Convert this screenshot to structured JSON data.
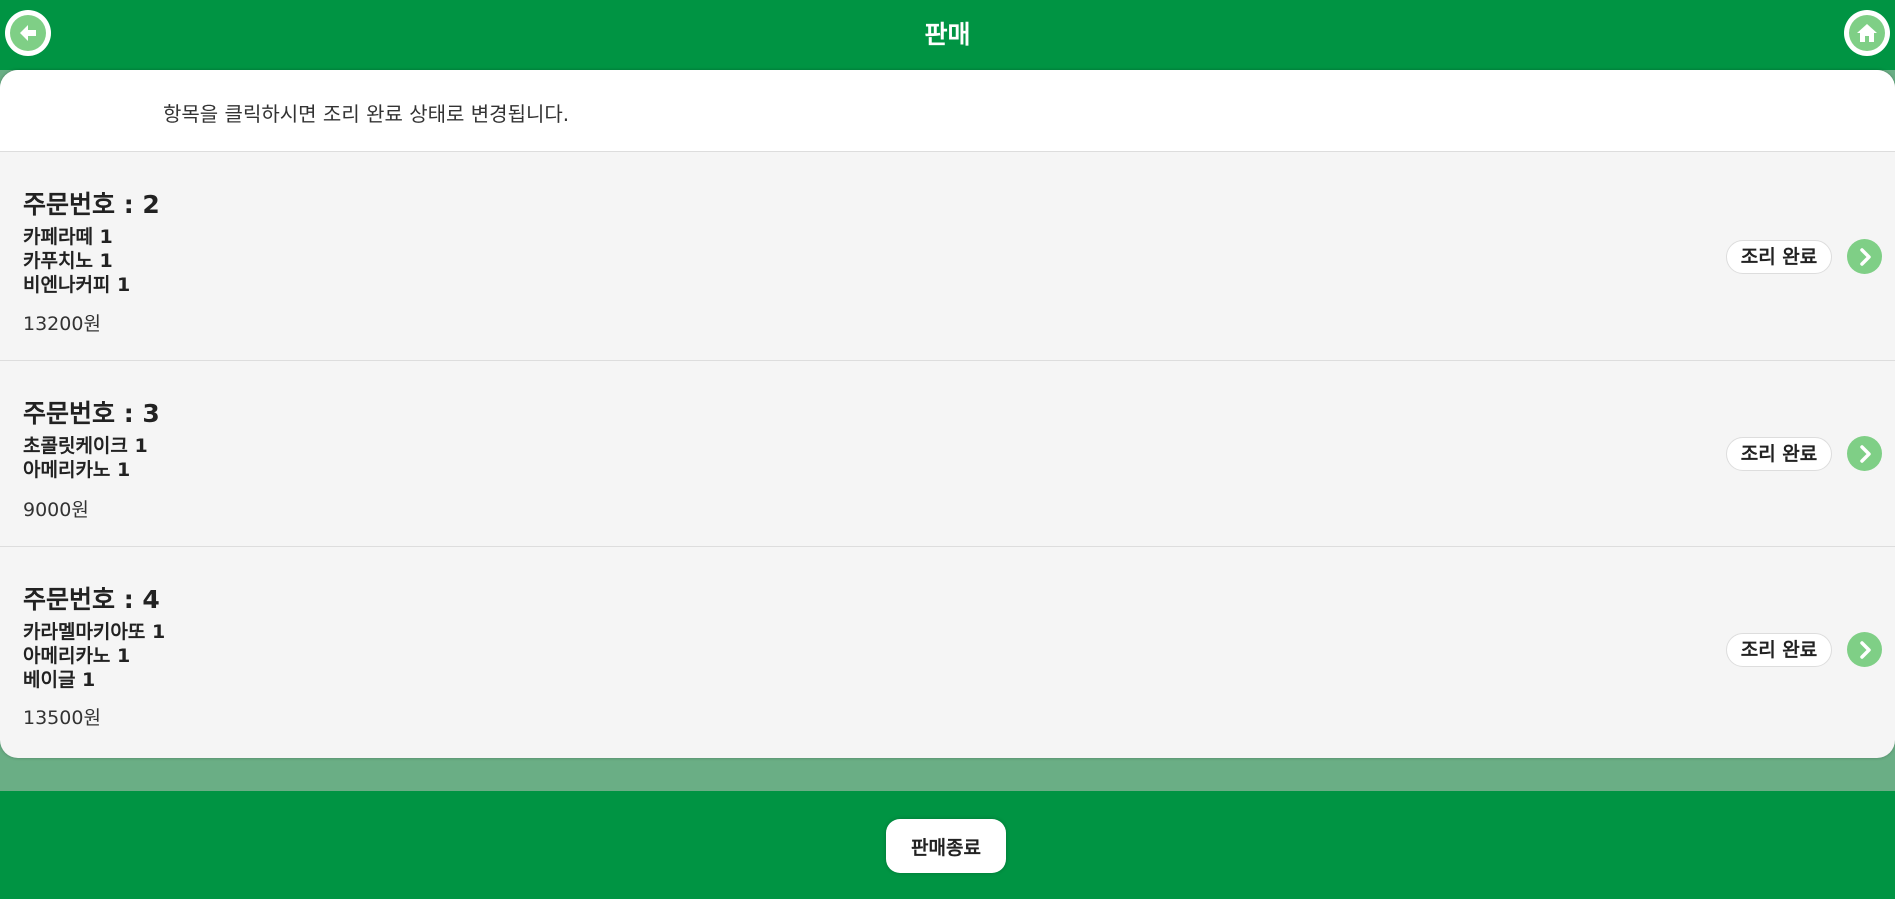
{
  "header": {
    "title": "판매",
    "back_icon": "arrow-left-icon",
    "home_icon": "home-icon"
  },
  "notice": "항목을 클릭하시면 조리 완료 상태로 변경됩니다.",
  "orders": [
    {
      "title": "주문번호 : 2",
      "items": [
        "카페라떼 1",
        "카푸치노 1",
        "비엔나커피 1"
      ],
      "price": "13200원",
      "status": "조리 완료"
    },
    {
      "title": "주문번호 : 3",
      "items": [
        "초콜릿케이크 1",
        "아메리카노 1"
      ],
      "price": "9000원",
      "status": "조리 완료"
    },
    {
      "title": "주문번호 : 4",
      "items": [
        "카라멜마키아또 1",
        "아메리카노 1",
        "베이글 1"
      ],
      "price": "13500원",
      "status": "조리 완료"
    }
  ],
  "footer": {
    "end_label": "판매종료"
  },
  "colors": {
    "brand_green": "#009443",
    "accent_light_green": "#7fcf86"
  }
}
